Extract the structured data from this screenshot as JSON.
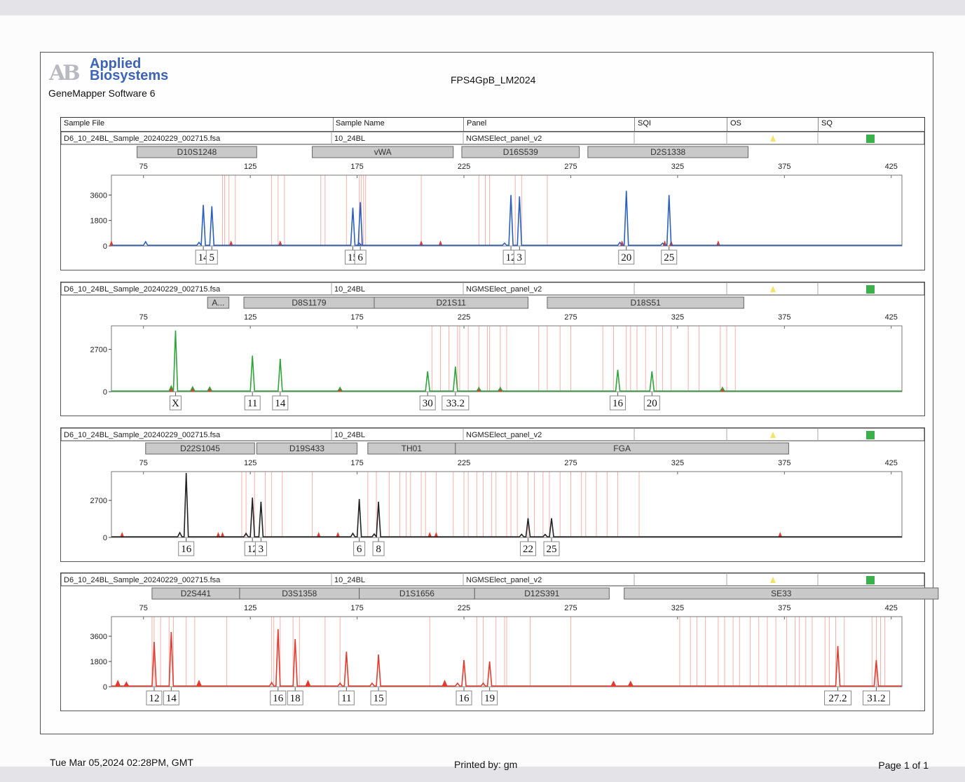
{
  "brand": {
    "line1": "Applied",
    "line2": "Biosystems",
    "software": "GeneMapper Software 6"
  },
  "title": "FPS4GpB_LM2024",
  "columns": {
    "sample_file": "Sample File",
    "sample_name": "Sample Name",
    "panel": "Panel",
    "sqi": "SQI",
    "os": "OS",
    "sq": "SQ"
  },
  "footer": {
    "printed_at": "Tue Mar 05,2024 02:28PM, GMT",
    "printed_by": "Printed by: gm",
    "page": "Page 1 of 1"
  },
  "colors": {
    "blue": "#2c5fbf",
    "green": "#2ea43a",
    "black": "#222222",
    "red": "#e23b2f",
    "bins": "#f4b0aa",
    "flag_yellow": "#f3e36a",
    "flag_green": "#3cb04a"
  },
  "chart_data": [
    {
      "type": "line",
      "sample_file": "D6_10_24BL_Sample_20240229_002715.fsa",
      "sample_name": "10_24BL",
      "panel": "NGMSElect_panel_v2",
      "color": "#2c5fbf",
      "xlim": [
        60,
        430
      ],
      "x_ticks": [
        75,
        125,
        175,
        225,
        275,
        325,
        375,
        425
      ],
      "ylim": [
        0,
        5000
      ],
      "y_ticks": [
        0,
        1800,
        3600
      ],
      "loci": [
        {
          "name": "D10S1248",
          "start": 72,
          "end": 128
        },
        {
          "name": "vWA",
          "start": 154,
          "end": 220
        },
        {
          "name": "D16S539",
          "start": 224,
          "end": 279
        },
        {
          "name": "D2S1338",
          "start": 283,
          "end": 358
        }
      ],
      "peaks": [
        {
          "x": 103,
          "y": 2900
        },
        {
          "x": 107,
          "y": 2800
        },
        {
          "x": 173,
          "y": 2700
        },
        {
          "x": 176.5,
          "y": 3100
        },
        {
          "x": 247,
          "y": 3600
        },
        {
          "x": 251,
          "y": 3500
        },
        {
          "x": 301,
          "y": 3900
        },
        {
          "x": 321,
          "y": 3600
        }
      ],
      "minor_peaks": [
        {
          "x": 76,
          "y": 300
        },
        {
          "x": 101,
          "y": 250
        },
        {
          "x": 176,
          "y": 200
        },
        {
          "x": 244,
          "y": 200
        },
        {
          "x": 298,
          "y": 250
        },
        {
          "x": 318,
          "y": 200
        }
      ],
      "markers": [
        60,
        116,
        139,
        205,
        214,
        299,
        319,
        322,
        344
      ],
      "bins": [
        112,
        113,
        115,
        118,
        135,
        138,
        141,
        158,
        160,
        170,
        176,
        177,
        178,
        179,
        205,
        232,
        235,
        237,
        249,
        252,
        264
      ],
      "calls": [
        {
          "label": "14",
          "x": 103
        },
        {
          "label": "5",
          "x": 107
        },
        {
          "label": "15",
          "x": 173
        },
        {
          "label": "6",
          "x": 176.5
        },
        {
          "label": "12",
          "x": 247
        },
        {
          "label": "3",
          "x": 251
        },
        {
          "label": "20",
          "x": 301
        },
        {
          "label": "25",
          "x": 321
        }
      ]
    },
    {
      "type": "line",
      "sample_file": "D6_10_24BL_Sample_20240229_002715.fsa",
      "sample_name": "10_24BL",
      "panel": "NGMSElect_panel_v2",
      "color": "#2ea43a",
      "xlim": [
        60,
        430
      ],
      "x_ticks": [
        75,
        125,
        175,
        225,
        275,
        325,
        375,
        425
      ],
      "ylim": [
        0,
        4200
      ],
      "y_ticks": [
        0,
        2700
      ],
      "loci": [
        {
          "name": "A...",
          "start": 105,
          "end": 115
        },
        {
          "name": "D8S1179",
          "start": 122,
          "end": 183
        },
        {
          "name": "D21S11",
          "start": 183,
          "end": 255
        },
        {
          "name": "D18S51",
          "start": 264,
          "end": 356
        }
      ],
      "peaks": [
        {
          "x": 90,
          "y": 3900
        },
        {
          "x": 126,
          "y": 2300
        },
        {
          "x": 139,
          "y": 2100
        },
        {
          "x": 208,
          "y": 1300
        },
        {
          "x": 221,
          "y": 1600
        },
        {
          "x": 297,
          "y": 1400
        },
        {
          "x": 313,
          "y": 1300
        }
      ],
      "minor_peaks": [
        {
          "x": 88,
          "y": 350
        },
        {
          "x": 98,
          "y": 300
        },
        {
          "x": 106,
          "y": 280
        },
        {
          "x": 167,
          "y": 250
        },
        {
          "x": 232,
          "y": 230
        },
        {
          "x": 242,
          "y": 230
        },
        {
          "x": 346,
          "y": 250
        }
      ],
      "markers": [
        88,
        98,
        106,
        167,
        232,
        242,
        346
      ],
      "bins": [
        210,
        214,
        218,
        222,
        223,
        227,
        232,
        236,
        237,
        242,
        245,
        260,
        264,
        270,
        275,
        290,
        295,
        301,
        303,
        306,
        310,
        315,
        318,
        322,
        330,
        335,
        345,
        348,
        352
      ],
      "calls": [
        {
          "label": "X",
          "x": 90
        },
        {
          "label": "11",
          "x": 126
        },
        {
          "label": "14",
          "x": 139
        },
        {
          "label": "30",
          "x": 208
        },
        {
          "label": "33.2",
          "x": 221
        },
        {
          "label": "16",
          "x": 297
        },
        {
          "label": "20",
          "x": 313
        }
      ]
    },
    {
      "type": "line",
      "sample_file": "D6_10_24BL_Sample_20240229_002715.fsa",
      "sample_name": "10_24BL",
      "panel": "NGMSElect_panel_v2",
      "color": "#222222",
      "xlim": [
        60,
        430
      ],
      "x_ticks": [
        75,
        125,
        175,
        225,
        275,
        325,
        375,
        425
      ],
      "ylim": [
        0,
        4800
      ],
      "y_ticks": [
        0,
        2700
      ],
      "loci": [
        {
          "name": "D22S1045",
          "start": 76,
          "end": 127
        },
        {
          "name": "D19S433",
          "start": 128,
          "end": 175
        },
        {
          "name": "TH01",
          "start": 180,
          "end": 221
        },
        {
          "name": "FGA",
          "start": 221,
          "end": 377
        }
      ],
      "peaks": [
        {
          "x": 95,
          "y": 4700
        },
        {
          "x": 126,
          "y": 2900
        },
        {
          "x": 130,
          "y": 2600
        },
        {
          "x": 176,
          "y": 2800
        },
        {
          "x": 185,
          "y": 2600
        },
        {
          "x": 255,
          "y": 1400
        },
        {
          "x": 266,
          "y": 1400
        }
      ],
      "minor_peaks": [
        {
          "x": 92,
          "y": 350
        },
        {
          "x": 123,
          "y": 300
        },
        {
          "x": 173,
          "y": 300
        },
        {
          "x": 183,
          "y": 250
        },
        {
          "x": 252,
          "y": 230
        },
        {
          "x": 263,
          "y": 220
        }
      ],
      "markers": [
        65,
        110,
        112,
        157,
        166,
        209,
        212,
        373
      ],
      "bins": [
        121,
        123,
        127,
        132,
        135,
        140,
        154,
        180,
        184,
        190,
        195,
        198,
        200,
        205,
        207,
        212,
        220,
        225,
        227,
        231,
        234,
        238,
        240,
        245,
        247,
        250,
        255,
        258,
        262,
        265,
        270,
        275,
        280,
        282,
        287,
        292,
        297,
        307
      ],
      "calls": [
        {
          "label": "16",
          "x": 95
        },
        {
          "label": "12",
          "x": 126
        },
        {
          "label": "3",
          "x": 130
        },
        {
          "label": "6",
          "x": 176
        },
        {
          "label": "8",
          "x": 185
        },
        {
          "label": "22",
          "x": 255
        },
        {
          "label": "25",
          "x": 266
        }
      ]
    },
    {
      "type": "line",
      "sample_file": "D6_10_24BL_Sample_20240229_002715.fsa",
      "sample_name": "10_24BL",
      "panel": "NGMSElect_panel_v2",
      "color": "#e23b2f",
      "xlim": [
        60,
        430
      ],
      "x_ticks": [
        75,
        125,
        175,
        225,
        275,
        325,
        375,
        425
      ],
      "ylim": [
        0,
        5000
      ],
      "y_ticks": [
        0,
        1800,
        3600
      ],
      "loci": [
        {
          "name": "D2S441",
          "start": 79,
          "end": 120
        },
        {
          "name": "D3S1358",
          "start": 120,
          "end": 176
        },
        {
          "name": "D1S1656",
          "start": 176,
          "end": 230
        },
        {
          "name": "D12S391",
          "start": 230,
          "end": 293
        },
        {
          "name": "SE33",
          "start": 300,
          "end": 447
        }
      ],
      "peaks": [
        {
          "x": 80,
          "y": 3200
        },
        {
          "x": 88,
          "y": 3900
        },
        {
          "x": 138,
          "y": 4100
        },
        {
          "x": 146,
          "y": 3400
        },
        {
          "x": 170,
          "y": 2500
        },
        {
          "x": 185,
          "y": 2300
        },
        {
          "x": 225,
          "y": 1900
        },
        {
          "x": 237,
          "y": 1800
        },
        {
          "x": 400,
          "y": 2900
        },
        {
          "x": 418,
          "y": 1900
        }
      ],
      "minor_peaks": [
        {
          "x": 63,
          "y": 400
        },
        {
          "x": 67,
          "y": 300
        },
        {
          "x": 101,
          "y": 400
        },
        {
          "x": 135,
          "y": 300
        },
        {
          "x": 152,
          "y": 400
        },
        {
          "x": 167,
          "y": 250
        },
        {
          "x": 182,
          "y": 250
        },
        {
          "x": 216,
          "y": 400
        },
        {
          "x": 222,
          "y": 250
        },
        {
          "x": 234,
          "y": 250
        },
        {
          "x": 295,
          "y": 350
        },
        {
          "x": 303,
          "y": 350
        }
      ],
      "markers": [
        63,
        67,
        101,
        152,
        216,
        295,
        303
      ],
      "bins": [
        79,
        80,
        83,
        87,
        89,
        95,
        99,
        114,
        135,
        136,
        139,
        145,
        148,
        160,
        167,
        209,
        231,
        234,
        240,
        244,
        245,
        256,
        275,
        326,
        331,
        334,
        338,
        344,
        347,
        351,
        354,
        359,
        363,
        367,
        371,
        376,
        380,
        382,
        385,
        388,
        394,
        396,
        399,
        403,
        416,
        418,
        420,
        422
      ],
      "calls": [
        {
          "label": "12",
          "x": 80
        },
        {
          "label": "14",
          "x": 88
        },
        {
          "label": "16",
          "x": 138
        },
        {
          "label": "18",
          "x": 146
        },
        {
          "label": "11",
          "x": 170
        },
        {
          "label": "15",
          "x": 185
        },
        {
          "label": "16",
          "x": 225
        },
        {
          "label": "19",
          "x": 237
        },
        {
          "label": "27.2",
          "x": 400
        },
        {
          "label": "31.2",
          "x": 418
        }
      ]
    }
  ]
}
